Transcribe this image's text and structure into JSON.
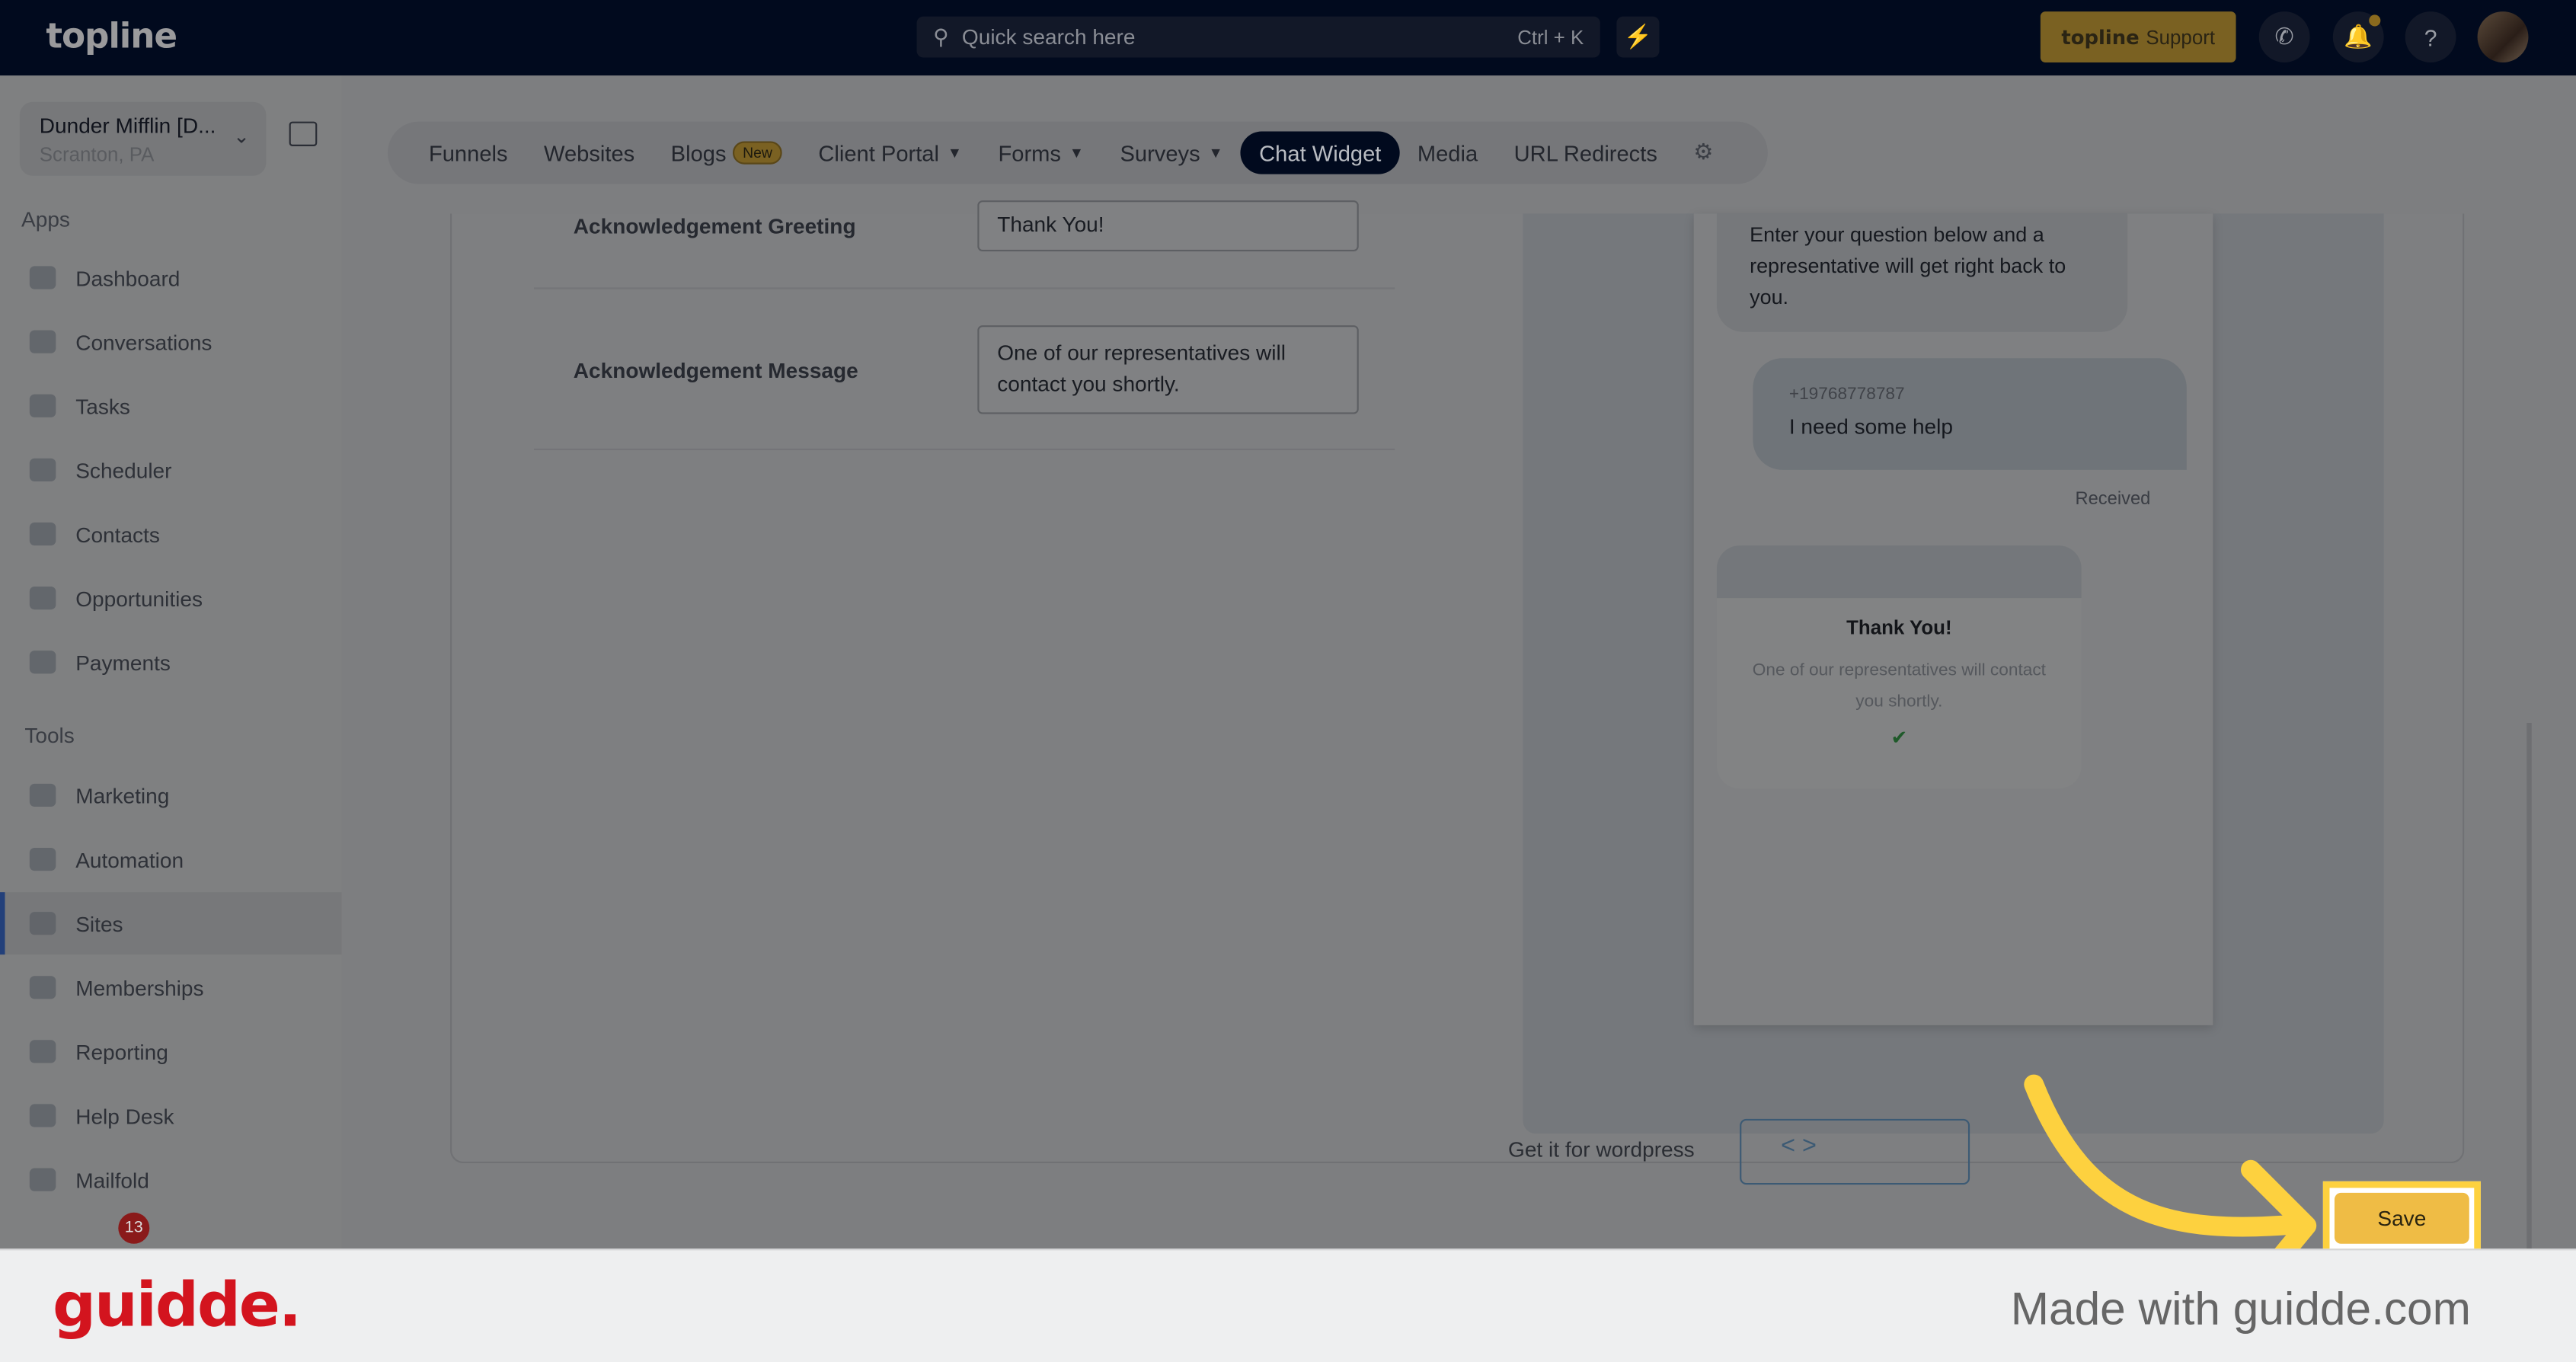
{
  "header": {
    "logo": "topline",
    "search_placeholder": "Quick search here",
    "search_shortcut": "Ctrl + K",
    "support_brand": "topline",
    "support_label": "Support"
  },
  "account": {
    "name": "Dunder Mifflin [D...",
    "location": "Scranton, PA"
  },
  "sidebar": {
    "apps_label": "Apps",
    "tools_label": "Tools",
    "apps": [
      {
        "label": "Dashboard"
      },
      {
        "label": "Conversations"
      },
      {
        "label": "Tasks"
      },
      {
        "label": "Scheduler"
      },
      {
        "label": "Contacts"
      },
      {
        "label": "Opportunities"
      },
      {
        "label": "Payments"
      }
    ],
    "tools": [
      {
        "label": "Marketing"
      },
      {
        "label": "Automation"
      },
      {
        "label": "Sites",
        "active": true
      },
      {
        "label": "Memberships"
      },
      {
        "label": "Reporting"
      },
      {
        "label": "Help Desk"
      },
      {
        "label": "Mailfold"
      }
    ],
    "notification_count": "13"
  },
  "tabs": [
    {
      "label": "Funnels"
    },
    {
      "label": "Websites"
    },
    {
      "label": "Blogs",
      "badge": "New"
    },
    {
      "label": "Client Portal"
    },
    {
      "label": "Forms"
    },
    {
      "label": "Surveys"
    },
    {
      "label": "Chat Widget",
      "active": true
    },
    {
      "label": "Media"
    },
    {
      "label": "URL Redirects"
    }
  ],
  "form": {
    "greeting_label": "Acknowledgement Greeting",
    "greeting_value": "Thank You!",
    "message_label": "Acknowledgement Message",
    "message_value": "One of our representatives will contact you shortly."
  },
  "preview": {
    "intro": "Enter your question below and a representative will get right back to you.",
    "phone": "+19768778787",
    "user_message": "I need some help",
    "status": "Received",
    "ack_title": "Thank You!",
    "ack_message": "One of our representatives will contact you shortly."
  },
  "footer_actions": {
    "wordpress_link": "Get it for wordpress",
    "save": "Save"
  },
  "guidde": {
    "logo": "guidde.",
    "made_with": "Made with guidde.com"
  },
  "colors": {
    "highlight": "#fdd13f",
    "save": "#efbc45",
    "topbar": "#010a1e"
  }
}
